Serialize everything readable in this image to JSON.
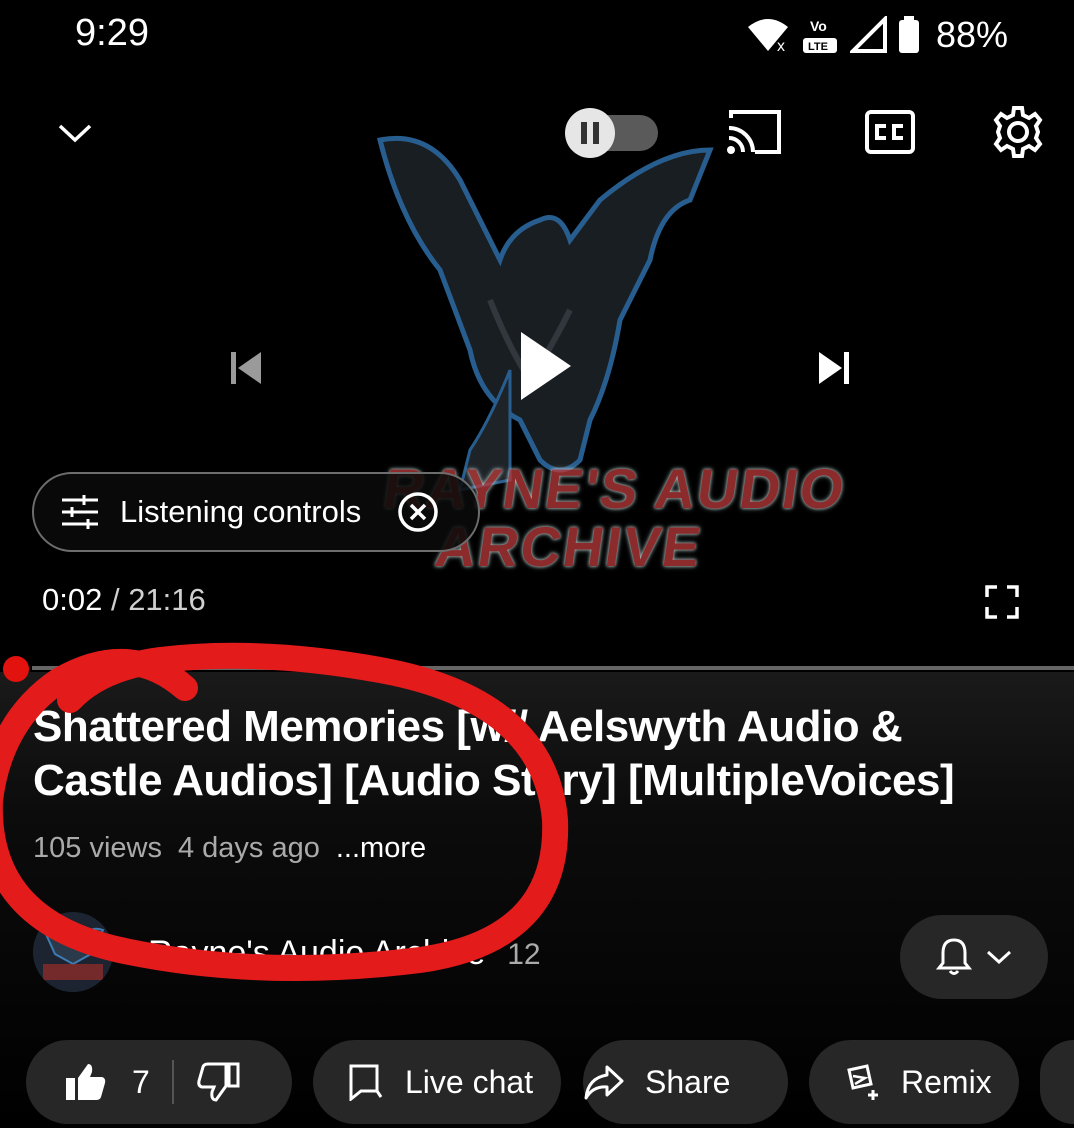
{
  "status_bar": {
    "time": "9:29",
    "volte_label": "Vo",
    "lte_label": "LTE",
    "battery": "88%"
  },
  "player": {
    "artwork_text_line1": "RAYNE'S AUDIO",
    "artwork_text_line2": "ARCHIVE",
    "listening_controls_label": "Listening controls",
    "current_time": "0:02",
    "time_separator": " / ",
    "duration": "21:16",
    "progress_fraction": 0.002
  },
  "video": {
    "title": "Shattered Memories [w// Aelswyth Audio & Castle Audios] [Audio Story] [MultipleVoices]",
    "views": "105 views",
    "age": "4 days ago",
    "more_label": "...more"
  },
  "channel": {
    "name": "Rayne's Audio Archive",
    "subscribers": "12",
    "avatar_text": "RAYNE'S AUDIO ARCHIVE"
  },
  "actions": {
    "like_count": "7",
    "live_chat": "Live chat",
    "share": "Share",
    "remix": "Remix"
  },
  "colors": {
    "accent": "#e2120f",
    "chip_bg": "#272727",
    "annotation": "#e31b1b"
  }
}
